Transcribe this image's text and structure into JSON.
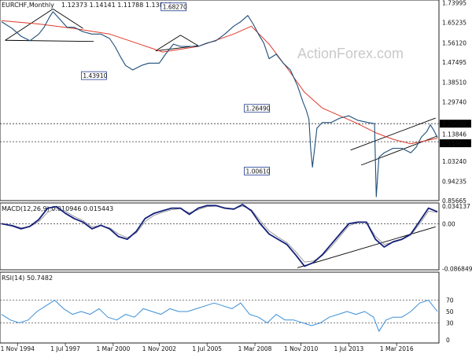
{
  "header": {
    "symbol_timeframe": "EURCHF,Monthly",
    "ohlc": "1.12373 1.14141 1.11788 1.13846"
  },
  "watermark": "ActionForex.com",
  "chart_data": [
    {
      "type": "line",
      "title": "EURCHF,Monthly",
      "x_ticks": [
        "1 Nov 1994",
        "1 Jul 1997",
        "1 Mar 2000",
        "1 Nov 2002",
        "1 Jul 2005",
        "1 Mar 2008",
        "1 Nov 2010",
        "1 Jul 2013",
        "1 Mar 2016"
      ],
      "y_ticks": [
        "1.73995",
        "1.65235",
        "1.56120",
        "1.47495",
        "1.38510",
        "1.29740",
        "1.20000",
        "1.13846",
        "1.11960",
        "1.03240",
        "0.94235",
        "0.85665"
      ],
      "ylim": [
        0.8566,
        1.752
      ],
      "price_series": {
        "name": "EURCHF",
        "x": [
          1993.9,
          1994.5,
          1995.0,
          1995.5,
          1996.0,
          1996.3,
          1996.6,
          1996.8,
          1997.2,
          1997.6,
          1998.0,
          1998.5,
          1999.0,
          1999.5,
          2000.0,
          2000.3,
          2000.6,
          2000.9,
          2001.3,
          2001.8,
          2002.2,
          2002.8,
          2003.2,
          2003.6,
          2004.0,
          2004.5,
          2005.0,
          2005.5,
          2006.0,
          2006.5,
          2007.0,
          2007.4,
          2007.8,
          2008.1,
          2008.4,
          2008.7,
          2009.0,
          2009.4,
          2009.8,
          2010.2,
          2010.6,
          2010.9,
          2011.1,
          2011.25,
          2011.35,
          2011.45,
          2011.7,
          2012.0,
          2012.5,
          2013.0,
          2013.5,
          2014.0,
          2014.6,
          2014.95,
          2015.05,
          2015.2,
          2015.5,
          2016.0,
          2016.5,
          2017.0,
          2017.3,
          2017.6,
          2017.9,
          2018.1,
          2018.3,
          2018.5
        ],
        "y": [
          1.655,
          1.625,
          1.59,
          1.57,
          1.6,
          1.63,
          1.675,
          1.7,
          1.665,
          1.63,
          1.63,
          1.61,
          1.6,
          1.6,
          1.58,
          1.545,
          1.5,
          1.46,
          1.44,
          1.46,
          1.47,
          1.47,
          1.515,
          1.555,
          1.545,
          1.545,
          1.545,
          1.56,
          1.57,
          1.6,
          1.635,
          1.655,
          1.683,
          1.645,
          1.6,
          1.56,
          1.49,
          1.51,
          1.47,
          1.44,
          1.37,
          1.3,
          1.26,
          1.22,
          1.085,
          1.006,
          1.18,
          1.205,
          1.205,
          1.225,
          1.235,
          1.215,
          1.205,
          1.2,
          0.8737,
          1.05,
          1.07,
          1.09,
          1.09,
          1.07,
          1.095,
          1.14,
          1.165,
          1.195,
          1.17,
          1.138
        ]
      },
      "ma_series": {
        "x": [
          1993.9,
          1996.0,
          1998.0,
          2000.0,
          2001.5,
          2003.0,
          2005.0,
          2007.0,
          2008.0,
          2009.0,
          2010.0,
          2011.0,
          2012.0,
          2013.0,
          2014.0,
          2015.0,
          2016.0,
          2017.0,
          2018.5
        ],
        "y": [
          1.66,
          1.645,
          1.625,
          1.6,
          1.56,
          1.52,
          1.545,
          1.6,
          1.635,
          1.555,
          1.45,
          1.34,
          1.27,
          1.235,
          1.2,
          1.16,
          1.13,
          1.11,
          1.135
        ]
      },
      "labels": [
        "1.68270",
        "1.43910",
        "1.26490",
        "1.00610"
      ],
      "levels": [
        "1.20000",
        "1.11960"
      ],
      "current_price": "1.13846"
    },
    {
      "type": "line",
      "title": "MACD(12,26,9) 0.010946 0.015443",
      "y_ticks": [
        "0.034137",
        "0.00",
        "-0.086849"
      ],
      "ylim": [
        -0.089,
        0.04
      ],
      "x": [
        1993.9,
        1994.5,
        1995.0,
        1995.5,
        1996.0,
        1996.5,
        1997.0,
        1997.5,
        1998.0,
        1998.5,
        1999.0,
        1999.5,
        2000.0,
        2000.5,
        2001.0,
        2001.5,
        2002.0,
        2002.5,
        2003.0,
        2003.5,
        2004.0,
        2004.5,
        2005.0,
        2005.5,
        2006.0,
        2006.5,
        2007.0,
        2007.5,
        2008.0,
        2008.5,
        2009.0,
        2009.5,
        2010.0,
        2010.5,
        2011.0,
        2011.5,
        2012.0,
        2012.5,
        2013.0,
        2013.5,
        2014.0,
        2014.5,
        2015.0,
        2015.5,
        2016.0,
        2016.5,
        2017.0,
        2017.5,
        2018.0,
        2018.5
      ],
      "macd": [
        0.0,
        -0.004,
        -0.01,
        -0.005,
        0.008,
        0.03,
        0.033,
        0.02,
        0.01,
        0.003,
        -0.01,
        -0.003,
        -0.01,
        -0.025,
        -0.03,
        -0.015,
        0.01,
        0.02,
        0.025,
        0.03,
        0.03,
        0.018,
        0.03,
        0.035,
        0.035,
        0.03,
        0.028,
        0.037,
        0.025,
        0.0,
        -0.02,
        -0.03,
        -0.04,
        -0.06,
        -0.082,
        -0.075,
        -0.06,
        -0.04,
        -0.02,
        0.0,
        0.003,
        0.003,
        -0.03,
        -0.045,
        -0.035,
        -0.03,
        -0.02,
        0.005,
        0.03,
        0.023
      ],
      "signal": [
        0.0,
        -0.003,
        -0.008,
        -0.006,
        0.004,
        0.022,
        0.03,
        0.024,
        0.014,
        0.006,
        -0.006,
        -0.004,
        -0.008,
        -0.02,
        -0.027,
        -0.018,
        0.004,
        0.016,
        0.022,
        0.027,
        0.029,
        0.021,
        0.027,
        0.033,
        0.034,
        0.031,
        0.029,
        0.034,
        0.027,
        0.006,
        -0.014,
        -0.026,
        -0.036,
        -0.054,
        -0.074,
        -0.072,
        -0.062,
        -0.045,
        -0.025,
        -0.004,
        0.002,
        0.002,
        -0.024,
        -0.04,
        -0.036,
        -0.031,
        -0.022,
        0.0,
        0.024,
        0.022
      ]
    },
    {
      "type": "line",
      "title": "RSI(14) 50.7482",
      "y_ticks": [
        "70",
        "50",
        "30",
        "0"
      ],
      "ylim": [
        0,
        100
      ],
      "x": [
        1993.9,
        1994.4,
        1994.9,
        1995.4,
        1995.9,
        1996.4,
        1996.9,
        1997.4,
        1997.9,
        1998.4,
        1998.9,
        1999.4,
        1999.9,
        2000.4,
        2000.9,
        2001.4,
        2001.9,
        2002.4,
        2002.9,
        2003.4,
        2003.9,
        2004.4,
        2004.9,
        2005.4,
        2005.9,
        2006.4,
        2006.9,
        2007.4,
        2007.9,
        2008.4,
        2008.9,
        2009.4,
        2009.9,
        2010.4,
        2010.9,
        2011.4,
        2011.9,
        2012.4,
        2012.9,
        2013.4,
        2013.9,
        2014.4,
        2014.9,
        2015.2,
        2015.6,
        2016.0,
        2016.5,
        2017.0,
        2017.5,
        2018.0,
        2018.5
      ],
      "values": [
        45,
        35,
        30,
        35,
        50,
        60,
        70,
        55,
        45,
        50,
        45,
        55,
        40,
        35,
        45,
        40,
        55,
        50,
        45,
        55,
        50,
        50,
        55,
        60,
        65,
        60,
        55,
        65,
        45,
        40,
        30,
        45,
        35,
        35,
        30,
        25,
        30,
        40,
        45,
        50,
        45,
        50,
        40,
        15,
        35,
        40,
        40,
        50,
        65,
        70,
        50
      ]
    }
  ]
}
